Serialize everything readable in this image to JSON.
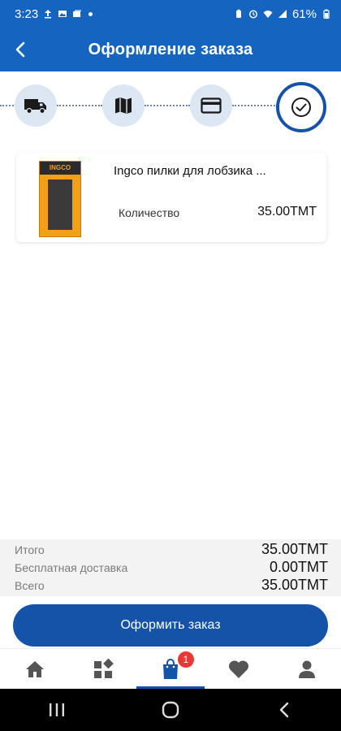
{
  "status_bar": {
    "time": "3:23",
    "battery": "61%",
    "left_icons": [
      "upload-icon",
      "image-icon",
      "gallery-icon",
      "dot-icon"
    ],
    "right_icons": [
      "battery-saver-icon",
      "alarm-icon",
      "wifi-icon",
      "signal-icon",
      "battery-icon"
    ]
  },
  "app_bar": {
    "title": "Оформление заказа",
    "back_icon": "chevron-left-icon"
  },
  "stepper": {
    "steps": [
      {
        "icon": "truck-icon",
        "active": false
      },
      {
        "icon": "map-icon",
        "active": false
      },
      {
        "icon": "credit-card-icon",
        "active": false
      },
      {
        "icon": "check-circle-icon",
        "active": true
      }
    ],
    "colors": {
      "inactive_bg": "#dde7f3",
      "active_border": "#1553a8"
    }
  },
  "cart_item": {
    "name": "Ingco пилки для лобзика ...",
    "quantity_label": "Количество",
    "price": "35.00TMT",
    "thumb_brand": "INGCO"
  },
  "summary": {
    "subtotal_label": "Итого",
    "subtotal_value": "35.00TMT",
    "delivery_label": "Бесплатная доставка",
    "delivery_value": "0.00TMT",
    "total_label": "Всего",
    "total_value": "35.00TMT"
  },
  "checkout": {
    "button_label": "Оформить заказ"
  },
  "bottom_nav": {
    "items": [
      {
        "icon": "home-icon",
        "active": false
      },
      {
        "icon": "categories-icon",
        "active": false
      },
      {
        "icon": "shopping-bag-icon",
        "active": true
      },
      {
        "icon": "heart-icon",
        "active": false
      },
      {
        "icon": "person-icon",
        "active": false
      }
    ],
    "cart_badge": "1",
    "accent": "#1553a8"
  },
  "system_nav": {
    "icons": [
      "recents-icon",
      "home-circle-icon",
      "back-icon"
    ]
  },
  "colors": {
    "primary": "#1565c0",
    "button": "#1553a8",
    "badge": "#e53935"
  }
}
